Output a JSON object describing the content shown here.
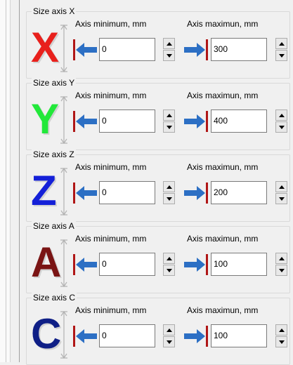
{
  "axes": [
    {
      "group_title": "Size axis X",
      "letter": "X",
      "letter_color": "#e8201c",
      "min_label": "Axis minimum, mm",
      "max_label": "Axis maximun, mm",
      "min_value": "0",
      "max_value": "300"
    },
    {
      "group_title": "Size axis Y",
      "letter": "Y",
      "letter_color": "#22e83a",
      "min_label": "Axis minimum, mm",
      "max_label": "Axis maximun, mm",
      "min_value": "0",
      "max_value": "400"
    },
    {
      "group_title": "Size axis Z",
      "letter": "Z",
      "letter_color": "#1420d8",
      "min_label": "Axis minimum, mm",
      "max_label": "Axis maximun, mm",
      "min_value": "0",
      "max_value": "200"
    },
    {
      "group_title": "Size axis A",
      "letter": "A",
      "letter_color": "#7a1414",
      "min_label": "Axis minimum, mm",
      "max_label": "Axis maximun, mm",
      "min_value": "0",
      "max_value": "100"
    },
    {
      "group_title": "Size axis C",
      "letter": "C",
      "letter_color": "#0f1f86",
      "min_label": "Axis minimum, mm",
      "max_label": "Axis maximun, mm",
      "min_value": "0",
      "max_value": "100"
    }
  ],
  "icons": {
    "min_arrow": "arrow-left-to-limit-icon",
    "max_arrow": "arrow-right-to-limit-icon",
    "spin_up": "triangle-up-icon",
    "spin_down": "triangle-down-icon",
    "size_marker": "vertical-dimension-icon"
  },
  "colors": {
    "arrow_blue": "#2c6fc4",
    "limit_red": "#b01616"
  }
}
